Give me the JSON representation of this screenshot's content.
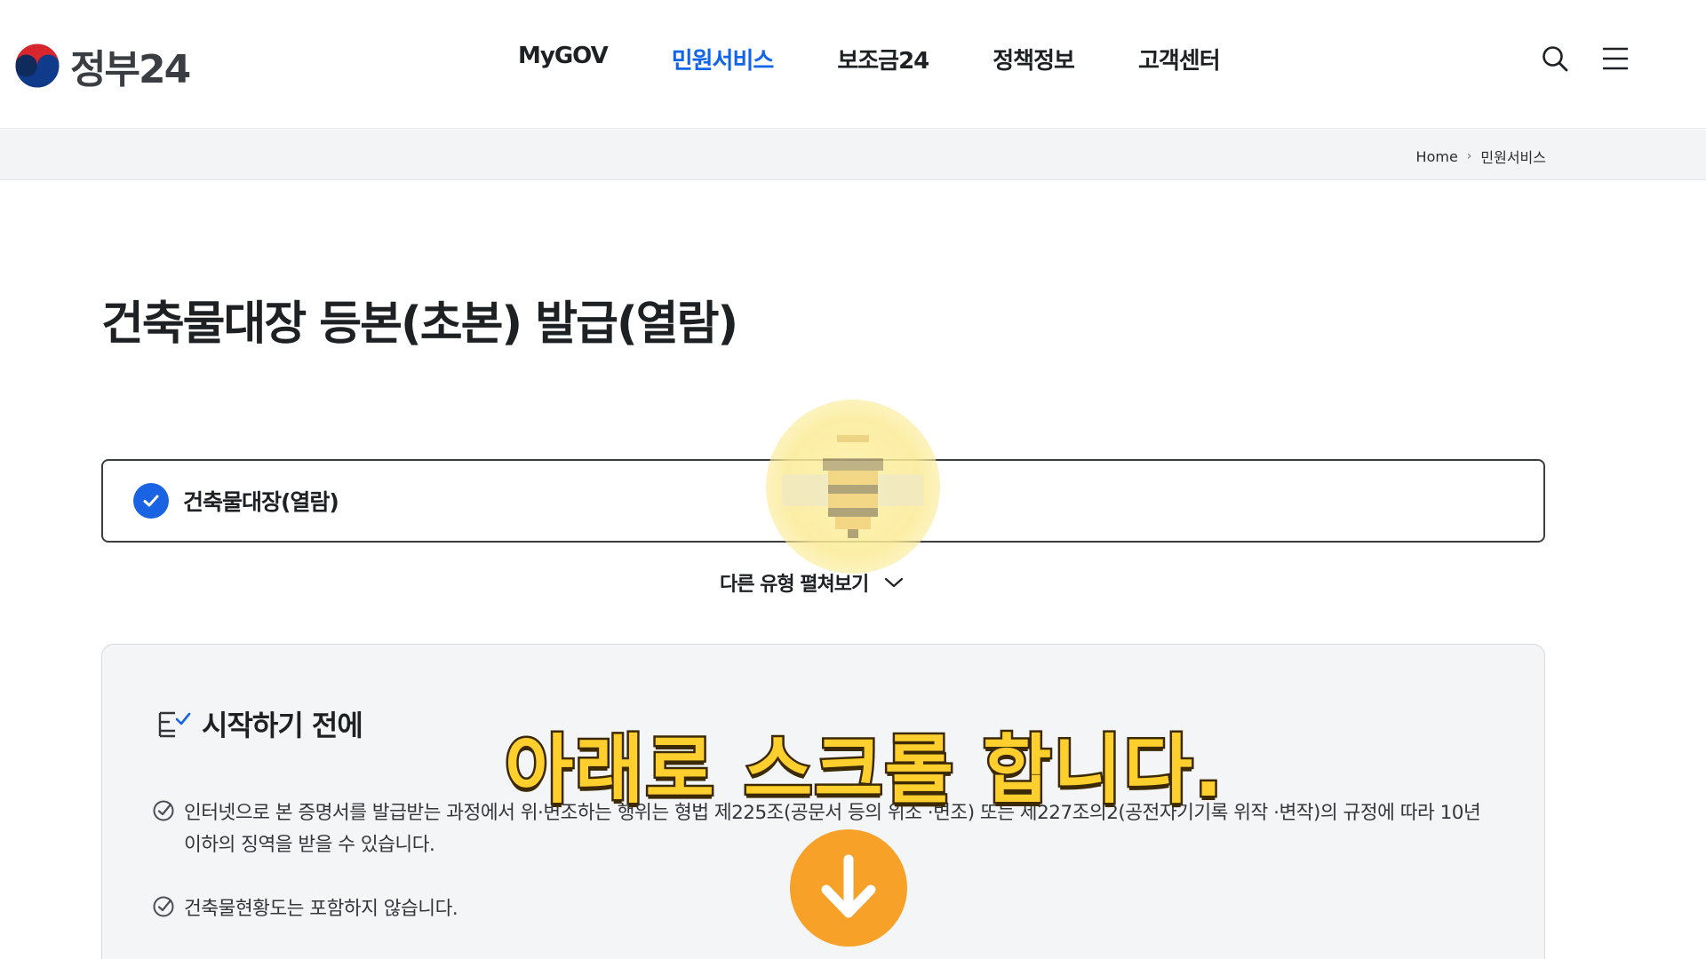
{
  "header": {
    "logo_text": "정부24",
    "nav": [
      {
        "label": "MyGOV",
        "active": false
      },
      {
        "label": "민원서비스",
        "active": true
      },
      {
        "label": "보조금24",
        "active": false
      },
      {
        "label": "정책정보",
        "active": false
      },
      {
        "label": "고객센터",
        "active": false
      }
    ],
    "icons": [
      "search-icon",
      "menu-icon"
    ]
  },
  "breadcrumb": {
    "home": "Home",
    "current": "민원서비스"
  },
  "page": {
    "title": "건축물대장 등본(초본) 발급(열람)"
  },
  "selected_type": {
    "label": "건축물대장(열람)"
  },
  "expand_link": {
    "label": "다른 유형 펼쳐보기"
  },
  "before_start": {
    "title": "시작하기 전에",
    "notices": [
      "인터넷으로 본 증명서를 발급받는 과정에서 위·변조하는 행위는 형법 제225조(공문서 등의 위조 ·변조) 또는 제227조의2(공전자기기록 위작 ·변작)의 규정에 따라 10년 이하의 징역을 받을 수 있습니다.",
      "건축물현황도는 포함하지 않습니다."
    ]
  },
  "overlay": {
    "caption": "아래로 스크롤 합니다.",
    "scroll_icon": "arrow-down-icon"
  },
  "colors": {
    "brand_blue": "#1165e8",
    "check_blue": "#1a63e3",
    "caption_yellow": "#ffcf2e",
    "scroll_orange": "#f7a128"
  }
}
